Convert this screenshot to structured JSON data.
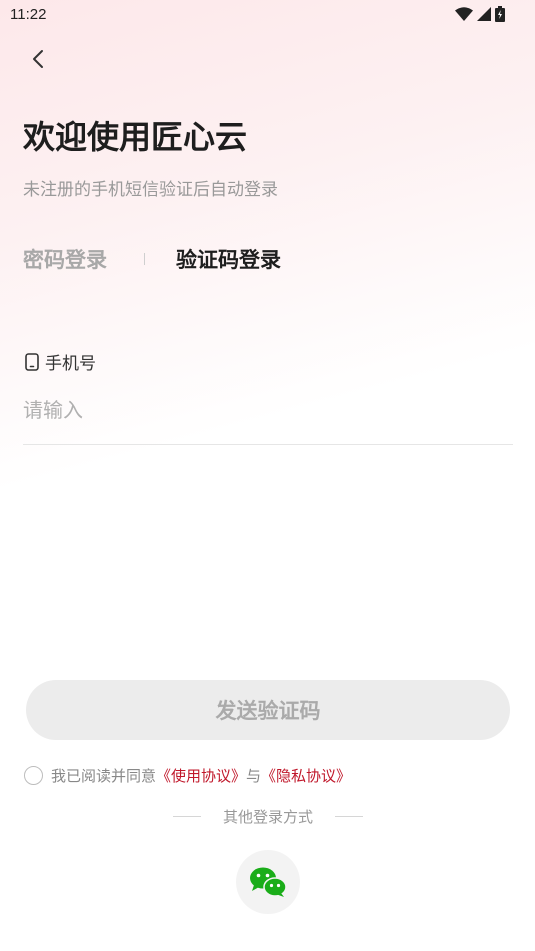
{
  "status_bar": {
    "time": "11:22",
    "icons": [
      "wifi-icon",
      "signal-icon",
      "battery-icon"
    ]
  },
  "header": {
    "back_icon": "chevron-left-icon",
    "title": "欢迎使用匠心云",
    "subtitle": "未注册的手机短信验证后自动登录"
  },
  "tabs": {
    "password_label": "密码登录",
    "code_label": "验证码登录",
    "active": "code"
  },
  "form": {
    "phone_icon": "phone-icon",
    "phone_label": "手机号",
    "phone_placeholder": "请输入",
    "phone_value": ""
  },
  "actions": {
    "send_code_label": "发送验证码"
  },
  "agreement": {
    "checked": false,
    "prefix": "我已阅读并同意",
    "terms_link": "《使用协议》",
    "conjunction": "与",
    "privacy_link": "《隐私协议》"
  },
  "other_login": {
    "label": "其他登录方式",
    "wechat_icon": "wechat-icon"
  },
  "colors": {
    "accent": "#c0182b",
    "wechat": "#1aad19",
    "disabled_button": "#ececec"
  }
}
